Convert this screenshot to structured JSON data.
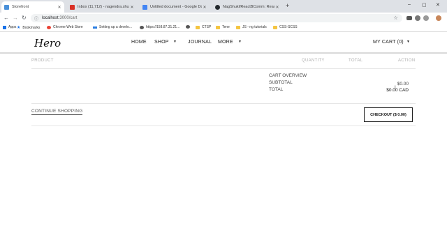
{
  "browser": {
    "tabs": [
      {
        "title": "Storefront",
        "favicon_color": "#4a90d9"
      },
      {
        "title": "Inbox (11,712) - nagendra.shukla...",
        "favicon_color": "#d93025"
      },
      {
        "title": "Untitled document - Google Docs",
        "favicon_color": "#4285f4"
      },
      {
        "title": "NagShukl/ReactBComm: React-...",
        "favicon_color": "#24292e"
      }
    ],
    "new_tab_glyph": "+",
    "url_host": "localhost",
    "url_path": ":3000/cart",
    "bookmarks": [
      {
        "label": "Apps",
        "icon": "apps-grid-icon"
      },
      {
        "label": "Bookmarks",
        "icon": "star-icon"
      },
      {
        "label": "Chrome Web Store",
        "icon": "chrome-store-icon"
      },
      {
        "label": "Setting up a develo...",
        "icon": "bookmark-link-icon"
      },
      {
        "label": "https://158.87.31.21...",
        "icon": "globe-icon"
      },
      {
        "label": "",
        "icon": "globe-icon"
      },
      {
        "label": "CTSP",
        "icon": "folder-icon"
      },
      {
        "label": "Tene",
        "icon": "folder-icon"
      },
      {
        "label": "JS - ng tutorials",
        "icon": "folder-icon"
      },
      {
        "label": "CSS-SCSS",
        "icon": "folder-icon"
      }
    ]
  },
  "site": {
    "logo": "Hero",
    "nav": {
      "home": "HOME",
      "shop": "SHOP",
      "journal": "JOURNAL",
      "more": "MORE",
      "cart": "MY CART (0)"
    }
  },
  "cart": {
    "headers": {
      "product": "PRODUCT",
      "quantity": "QUANTITY",
      "total": "TOTAL",
      "action": "ACTION"
    },
    "overview_title": "CART OVERVIEW",
    "subtotal_label": "SUBTOTAL",
    "subtotal_value": "$0.00",
    "total_label": "TOTAL",
    "total_value": "$0.00 CAD",
    "continue_label": "CONTINUE SHOPPING",
    "checkout_label": "CHECKOUT ($ 0.00)"
  }
}
